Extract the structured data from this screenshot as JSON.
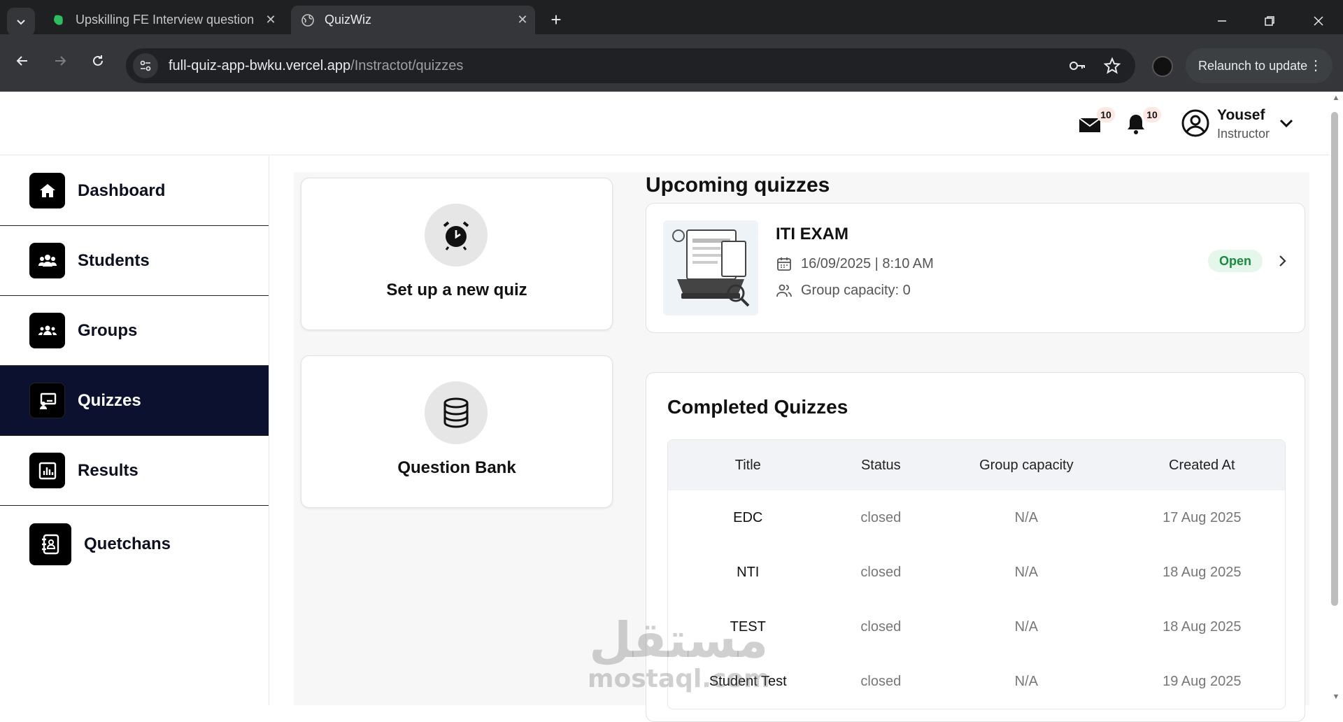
{
  "browser": {
    "tabs": [
      {
        "title": "Upskilling FE Interview question",
        "active": false
      },
      {
        "title": "QuizWiz",
        "active": true
      }
    ],
    "url_host": "full-quiz-app-bwku.vercel.app",
    "url_path": "/Instractot/quizzes",
    "relaunch_label": "Relaunch to update"
  },
  "header": {
    "mail_count": "10",
    "notification_count": "10",
    "user_name": "Yousef",
    "user_role": "Instructor"
  },
  "sidebar": {
    "items": [
      {
        "label": "Dashboard",
        "icon": "home-icon"
      },
      {
        "label": "Students",
        "icon": "users-icon"
      },
      {
        "label": "Groups",
        "icon": "groups-icon"
      },
      {
        "label": "Quizzes",
        "icon": "quiz-icon",
        "active": true
      },
      {
        "label": "Results",
        "icon": "chart-icon"
      },
      {
        "label": "Quetchans",
        "icon": "contacts-icon"
      }
    ]
  },
  "actions": {
    "new_quiz_label": "Set up a new quiz",
    "question_bank_label": "Question Bank"
  },
  "upcoming": {
    "title": "Upcoming quizzes",
    "quiz": {
      "name": "ITI EXAM",
      "datetime": "16/09/2025 | 8:10 AM",
      "capacity": "Group capacity: 0",
      "status": "Open"
    }
  },
  "completed": {
    "title": "Completed Quizzes",
    "columns": [
      "Title",
      "Status",
      "Group capacity",
      "Created At"
    ],
    "rows": [
      [
        "EDC",
        "closed",
        "N/A",
        "17 Aug 2025"
      ],
      [
        "NTI",
        "closed",
        "N/A",
        "18 Aug 2025"
      ],
      [
        "TEST",
        "closed",
        "N/A",
        "18 Aug 2025"
      ],
      [
        "Student Test",
        "closed",
        "N/A",
        "19 Aug 2025"
      ]
    ]
  },
  "watermark": {
    "arabic": "مستقل",
    "latin": "mostaql.com"
  },
  "colors": {
    "sidebar_active": "#0d1130",
    "open_status": "#1a8a3d",
    "badge_bg": "#fde8e4"
  }
}
